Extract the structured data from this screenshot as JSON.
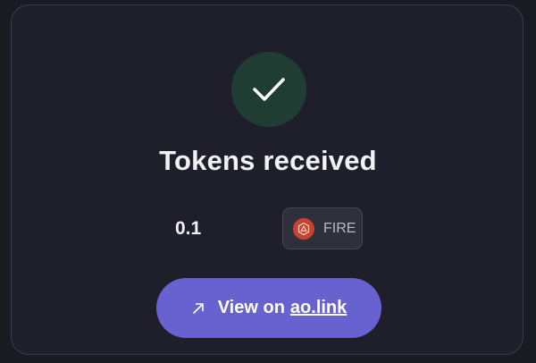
{
  "dialog": {
    "title": "Tokens received",
    "icon": "checkmark-icon",
    "success_color": "#1f3d33"
  },
  "transfer": {
    "amount": "0.1",
    "token_ticker": "FIRE",
    "token_icon": "fire-token-logo-icon",
    "token_color": "#c8432c"
  },
  "action": {
    "icon": "arrow-up-right-icon",
    "label_prefix": "View on",
    "link_text": "ao.link",
    "button_color": "#6762cf"
  }
}
